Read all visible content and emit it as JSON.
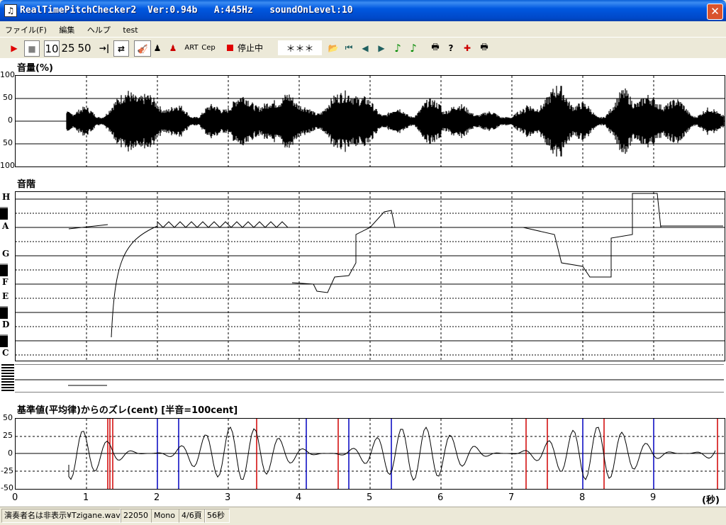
{
  "window": {
    "title": "RealTimePitchChecker2  Ver:0.94b   A:445Hz   soundOnLevel:10",
    "close_symbol": "✕"
  },
  "menu": [
    "ファイル(F)",
    "編集",
    "ヘルプ",
    "test"
  ],
  "toolbar": {
    "buttons": [
      {
        "name": "play-icon",
        "label": "▶",
        "color": "#e00000"
      },
      {
        "name": "stop-icon",
        "label": "■",
        "color": "#808080"
      },
      {
        "name": "zoom-10-button",
        "label": "10"
      },
      {
        "name": "zoom-25-button",
        "label": "25"
      },
      {
        "name": "zoom-50-button",
        "label": "50"
      },
      {
        "name": "jump-end-icon",
        "label": "→|"
      },
      {
        "name": "loop-icon",
        "label": "⇄"
      },
      {
        "name": "violin-icon",
        "label": "🎻"
      },
      {
        "name": "person-black-icon",
        "label": "♟"
      },
      {
        "name": "person-red-icon",
        "label": "♟",
        "color": "#cc0000"
      },
      {
        "name": "art-button",
        "label": "ART"
      },
      {
        "name": "cep-button",
        "label": "Cep"
      }
    ],
    "record_button_label": "停止中",
    "status_text": "＊＊＊",
    "right_buttons": [
      {
        "name": "open-folder-icon",
        "label": "📂"
      },
      {
        "name": "first-icon",
        "label": "⏮"
      },
      {
        "name": "prev-icon",
        "label": "◀"
      },
      {
        "name": "next-icon",
        "label": "▶"
      },
      {
        "name": "note-green-icon",
        "label": "♪",
        "color": "#008800"
      },
      {
        "name": "note-green2-icon",
        "label": "♪",
        "color": "#008800"
      },
      {
        "name": "print-icon",
        "label": "🖶"
      },
      {
        "name": "help-icon",
        "label": "?"
      },
      {
        "name": "marker-icon",
        "label": "✚",
        "color": "#cc0000"
      },
      {
        "name": "print2-icon",
        "label": "🖶"
      }
    ]
  },
  "volume_panel": {
    "title": "音量(%)",
    "y_ticks": [
      "100",
      "50",
      "0",
      "50",
      "100"
    ]
  },
  "scale_panel": {
    "title": "音階",
    "notes": [
      "H",
      "A",
      "G",
      "F",
      "E",
      "D",
      "C"
    ]
  },
  "deviation_panel": {
    "title": "基準値(平均律)からのズレ(cent) [半音=100cent]",
    "y_ticks": [
      "50",
      "25",
      "0",
      "-25",
      "-50"
    ]
  },
  "x_axis": {
    "ticks": [
      "0",
      "1",
      "2",
      "3",
      "4",
      "5",
      "6",
      "7",
      "8",
      "9"
    ],
    "unit_label": "(秒)",
    "max": 10
  },
  "status": {
    "file": "演奏者名は非表示¥Tzigane.wav",
    "rate": "22050",
    "channels": "Mono",
    "page": "4/6頁",
    "duration": "56秒"
  }
}
